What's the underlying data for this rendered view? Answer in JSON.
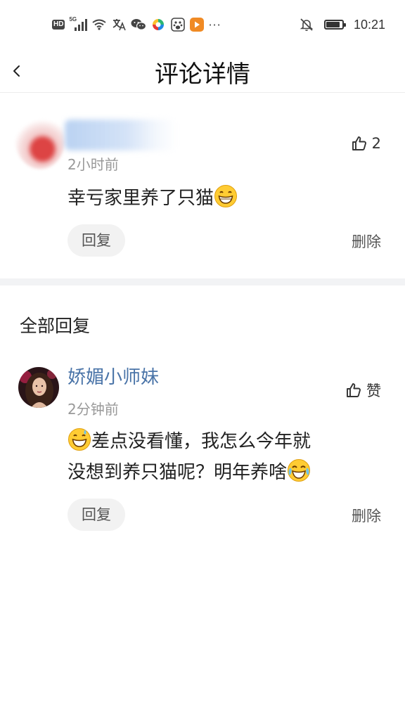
{
  "status_bar": {
    "hd_badge": "HD",
    "network_label": "5G",
    "time": "10:21",
    "battery_level": 0.85,
    "icons": [
      "hd-icon",
      "signal-5g-icon",
      "wifi-icon",
      "translate-icon",
      "wechat-icon",
      "app-icon",
      "baidu-icon",
      "video-app-icon",
      "more-dots-icon",
      "mute-bell-icon",
      "battery-icon"
    ],
    "more": "···"
  },
  "nav": {
    "title": "评论详情",
    "back_icon": "chevron-left-icon"
  },
  "main_comment": {
    "time": "2小时前",
    "likes": "2",
    "text": "幸亏家里养了只猫",
    "emoji": "grinning-face-emoji",
    "reply_label": "回复",
    "delete_label": "删除"
  },
  "replies_section": {
    "title": "全部回复"
  },
  "replies": [
    {
      "username": "娇媚小师妹",
      "time": "2分钟前",
      "like_label": "赞",
      "text_part1": "差点没看懂，我怎么今年就",
      "text_part2": "没想到养只猫呢？明年养啥",
      "emoji_start": "grinning-sweat-emoji",
      "emoji_end": "tears-of-joy-emoji",
      "reply_label": "回复",
      "delete_label": "删除"
    }
  ],
  "colors": {
    "username": "#4a74a8",
    "meta": "#999999",
    "divider": "#f2f3f5",
    "pill_bg": "#f2f2f2"
  }
}
